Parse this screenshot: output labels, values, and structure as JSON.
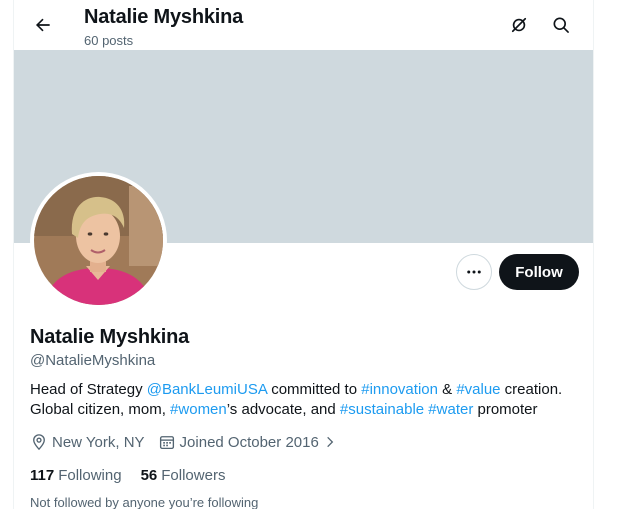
{
  "header": {
    "title": "Natalie Myshkina",
    "posts_count": "60 posts",
    "back_icon": "arrow-left-icon",
    "grok_icon": "grok-icon",
    "search_icon": "search-icon"
  },
  "profile": {
    "display_name": "Natalie Myshkina",
    "handle": "@NatalieMyshkina",
    "bio": {
      "t1": "Head of Strategy ",
      "m1": "@BankLeumiUSA",
      "t2": " committed to ",
      "h1": "#innovation",
      "t3": " & ",
      "h2": "#value",
      "t4": " creation.",
      "t5": "Global citizen, mom, ",
      "h3": "#women",
      "t6": "’s advocate, and ",
      "h4": "#sustainable",
      "t7": " ",
      "h5": "#water",
      "t8": " promoter"
    },
    "location": "New York, NY",
    "joined": "Joined October 2016",
    "following_count": "117",
    "following_label": "Following",
    "followers_count": "56",
    "followers_label": "Followers",
    "followed_by_note": "Not followed by anyone you’re following"
  },
  "actions": {
    "follow_label": "Follow",
    "more_icon": "more-horizontal-icon"
  },
  "colors": {
    "banner": "#cfd9de",
    "link": "#1d9bf0",
    "primary_button": "#0f1419",
    "secondary_text": "#536471"
  }
}
